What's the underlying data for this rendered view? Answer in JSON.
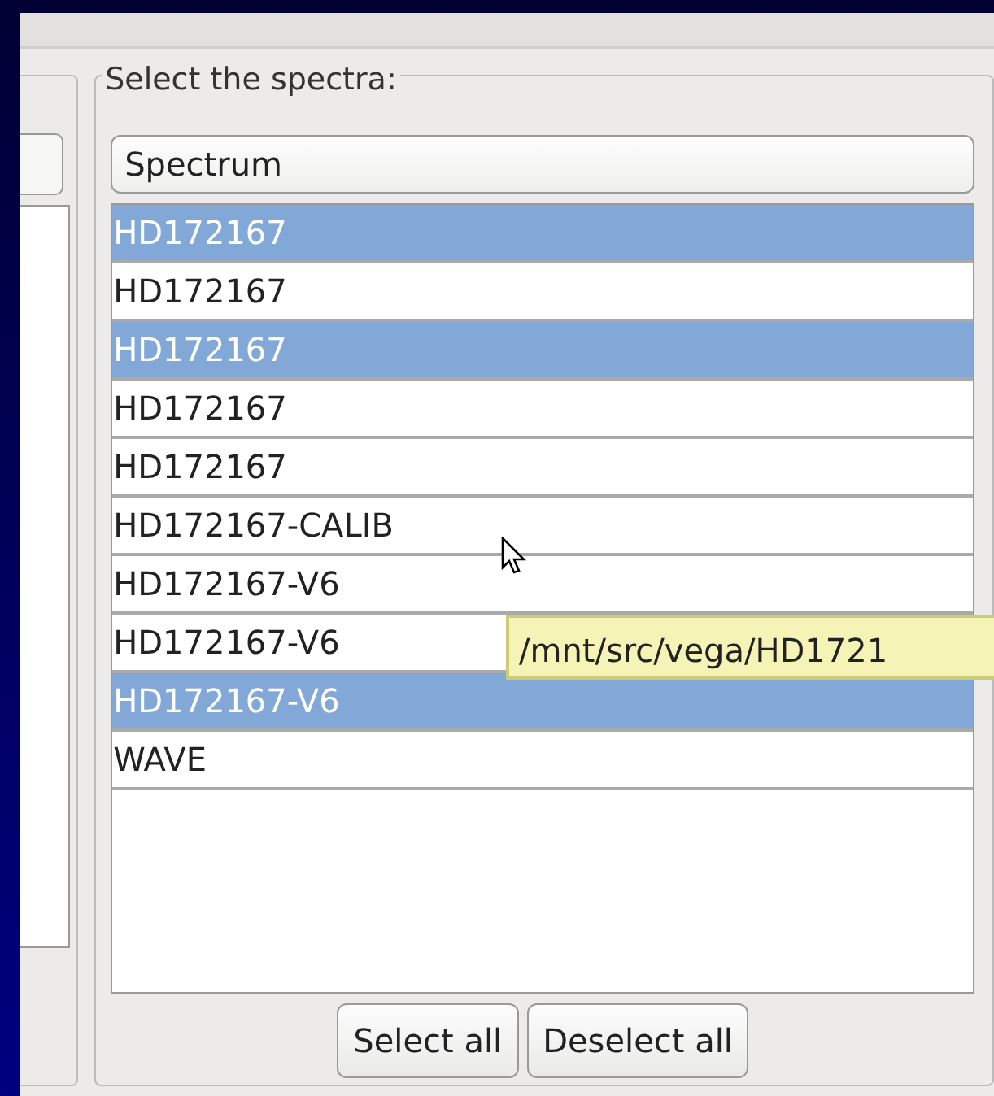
{
  "group_title": "Select the spectra:",
  "list_header": "Spectrum",
  "rows": [
    {
      "label": "HD172167",
      "selected": true
    },
    {
      "label": "HD172167",
      "selected": false
    },
    {
      "label": "HD172167",
      "selected": true
    },
    {
      "label": "HD172167",
      "selected": false
    },
    {
      "label": "HD172167",
      "selected": false
    },
    {
      "label": "HD172167-CALIB",
      "selected": false
    },
    {
      "label": "HD172167-V6",
      "selected": false
    },
    {
      "label": "HD172167-V6",
      "selected": false
    },
    {
      "label": "HD172167-V6",
      "selected": true
    },
    {
      "label": "WAVE",
      "selected": false
    }
  ],
  "tooltip": "/mnt/src/vega/HD1721",
  "buttons": [
    "Select all",
    "Deselect all"
  ]
}
